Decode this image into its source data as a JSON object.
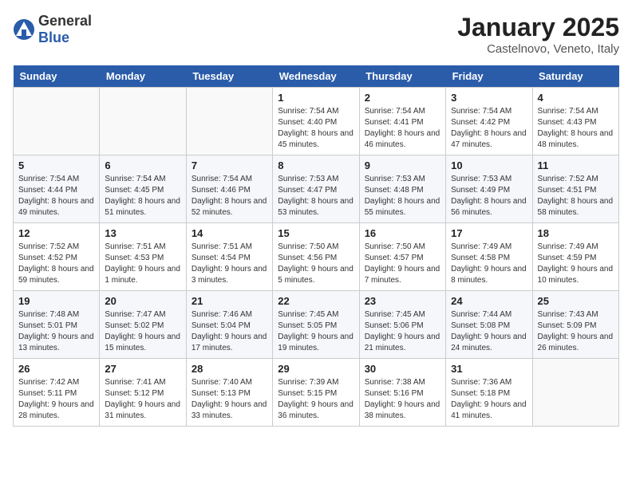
{
  "header": {
    "logo_general": "General",
    "logo_blue": "Blue",
    "title": "January 2025",
    "subtitle": "Castelnovo, Veneto, Italy"
  },
  "weekdays": [
    "Sunday",
    "Monday",
    "Tuesday",
    "Wednesday",
    "Thursday",
    "Friday",
    "Saturday"
  ],
  "weeks": [
    [
      {
        "day": "",
        "sunrise": "",
        "sunset": "",
        "daylight": ""
      },
      {
        "day": "",
        "sunrise": "",
        "sunset": "",
        "daylight": ""
      },
      {
        "day": "",
        "sunrise": "",
        "sunset": "",
        "daylight": ""
      },
      {
        "day": "1",
        "sunrise": "Sunrise: 7:54 AM",
        "sunset": "Sunset: 4:40 PM",
        "daylight": "Daylight: 8 hours and 45 minutes."
      },
      {
        "day": "2",
        "sunrise": "Sunrise: 7:54 AM",
        "sunset": "Sunset: 4:41 PM",
        "daylight": "Daylight: 8 hours and 46 minutes."
      },
      {
        "day": "3",
        "sunrise": "Sunrise: 7:54 AM",
        "sunset": "Sunset: 4:42 PM",
        "daylight": "Daylight: 8 hours and 47 minutes."
      },
      {
        "day": "4",
        "sunrise": "Sunrise: 7:54 AM",
        "sunset": "Sunset: 4:43 PM",
        "daylight": "Daylight: 8 hours and 48 minutes."
      }
    ],
    [
      {
        "day": "5",
        "sunrise": "Sunrise: 7:54 AM",
        "sunset": "Sunset: 4:44 PM",
        "daylight": "Daylight: 8 hours and 49 minutes."
      },
      {
        "day": "6",
        "sunrise": "Sunrise: 7:54 AM",
        "sunset": "Sunset: 4:45 PM",
        "daylight": "Daylight: 8 hours and 51 minutes."
      },
      {
        "day": "7",
        "sunrise": "Sunrise: 7:54 AM",
        "sunset": "Sunset: 4:46 PM",
        "daylight": "Daylight: 8 hours and 52 minutes."
      },
      {
        "day": "8",
        "sunrise": "Sunrise: 7:53 AM",
        "sunset": "Sunset: 4:47 PM",
        "daylight": "Daylight: 8 hours and 53 minutes."
      },
      {
        "day": "9",
        "sunrise": "Sunrise: 7:53 AM",
        "sunset": "Sunset: 4:48 PM",
        "daylight": "Daylight: 8 hours and 55 minutes."
      },
      {
        "day": "10",
        "sunrise": "Sunrise: 7:53 AM",
        "sunset": "Sunset: 4:49 PM",
        "daylight": "Daylight: 8 hours and 56 minutes."
      },
      {
        "day": "11",
        "sunrise": "Sunrise: 7:52 AM",
        "sunset": "Sunset: 4:51 PM",
        "daylight": "Daylight: 8 hours and 58 minutes."
      }
    ],
    [
      {
        "day": "12",
        "sunrise": "Sunrise: 7:52 AM",
        "sunset": "Sunset: 4:52 PM",
        "daylight": "Daylight: 8 hours and 59 minutes."
      },
      {
        "day": "13",
        "sunrise": "Sunrise: 7:51 AM",
        "sunset": "Sunset: 4:53 PM",
        "daylight": "Daylight: 9 hours and 1 minute."
      },
      {
        "day": "14",
        "sunrise": "Sunrise: 7:51 AM",
        "sunset": "Sunset: 4:54 PM",
        "daylight": "Daylight: 9 hours and 3 minutes."
      },
      {
        "day": "15",
        "sunrise": "Sunrise: 7:50 AM",
        "sunset": "Sunset: 4:56 PM",
        "daylight": "Daylight: 9 hours and 5 minutes."
      },
      {
        "day": "16",
        "sunrise": "Sunrise: 7:50 AM",
        "sunset": "Sunset: 4:57 PM",
        "daylight": "Daylight: 9 hours and 7 minutes."
      },
      {
        "day": "17",
        "sunrise": "Sunrise: 7:49 AM",
        "sunset": "Sunset: 4:58 PM",
        "daylight": "Daylight: 9 hours and 8 minutes."
      },
      {
        "day": "18",
        "sunrise": "Sunrise: 7:49 AM",
        "sunset": "Sunset: 4:59 PM",
        "daylight": "Daylight: 9 hours and 10 minutes."
      }
    ],
    [
      {
        "day": "19",
        "sunrise": "Sunrise: 7:48 AM",
        "sunset": "Sunset: 5:01 PM",
        "daylight": "Daylight: 9 hours and 13 minutes."
      },
      {
        "day": "20",
        "sunrise": "Sunrise: 7:47 AM",
        "sunset": "Sunset: 5:02 PM",
        "daylight": "Daylight: 9 hours and 15 minutes."
      },
      {
        "day": "21",
        "sunrise": "Sunrise: 7:46 AM",
        "sunset": "Sunset: 5:04 PM",
        "daylight": "Daylight: 9 hours and 17 minutes."
      },
      {
        "day": "22",
        "sunrise": "Sunrise: 7:45 AM",
        "sunset": "Sunset: 5:05 PM",
        "daylight": "Daylight: 9 hours and 19 minutes."
      },
      {
        "day": "23",
        "sunrise": "Sunrise: 7:45 AM",
        "sunset": "Sunset: 5:06 PM",
        "daylight": "Daylight: 9 hours and 21 minutes."
      },
      {
        "day": "24",
        "sunrise": "Sunrise: 7:44 AM",
        "sunset": "Sunset: 5:08 PM",
        "daylight": "Daylight: 9 hours and 24 minutes."
      },
      {
        "day": "25",
        "sunrise": "Sunrise: 7:43 AM",
        "sunset": "Sunset: 5:09 PM",
        "daylight": "Daylight: 9 hours and 26 minutes."
      }
    ],
    [
      {
        "day": "26",
        "sunrise": "Sunrise: 7:42 AM",
        "sunset": "Sunset: 5:11 PM",
        "daylight": "Daylight: 9 hours and 28 minutes."
      },
      {
        "day": "27",
        "sunrise": "Sunrise: 7:41 AM",
        "sunset": "Sunset: 5:12 PM",
        "daylight": "Daylight: 9 hours and 31 minutes."
      },
      {
        "day": "28",
        "sunrise": "Sunrise: 7:40 AM",
        "sunset": "Sunset: 5:13 PM",
        "daylight": "Daylight: 9 hours and 33 minutes."
      },
      {
        "day": "29",
        "sunrise": "Sunrise: 7:39 AM",
        "sunset": "Sunset: 5:15 PM",
        "daylight": "Daylight: 9 hours and 36 minutes."
      },
      {
        "day": "30",
        "sunrise": "Sunrise: 7:38 AM",
        "sunset": "Sunset: 5:16 PM",
        "daylight": "Daylight: 9 hours and 38 minutes."
      },
      {
        "day": "31",
        "sunrise": "Sunrise: 7:36 AM",
        "sunset": "Sunset: 5:18 PM",
        "daylight": "Daylight: 9 hours and 41 minutes."
      },
      {
        "day": "",
        "sunrise": "",
        "sunset": "",
        "daylight": ""
      }
    ]
  ]
}
